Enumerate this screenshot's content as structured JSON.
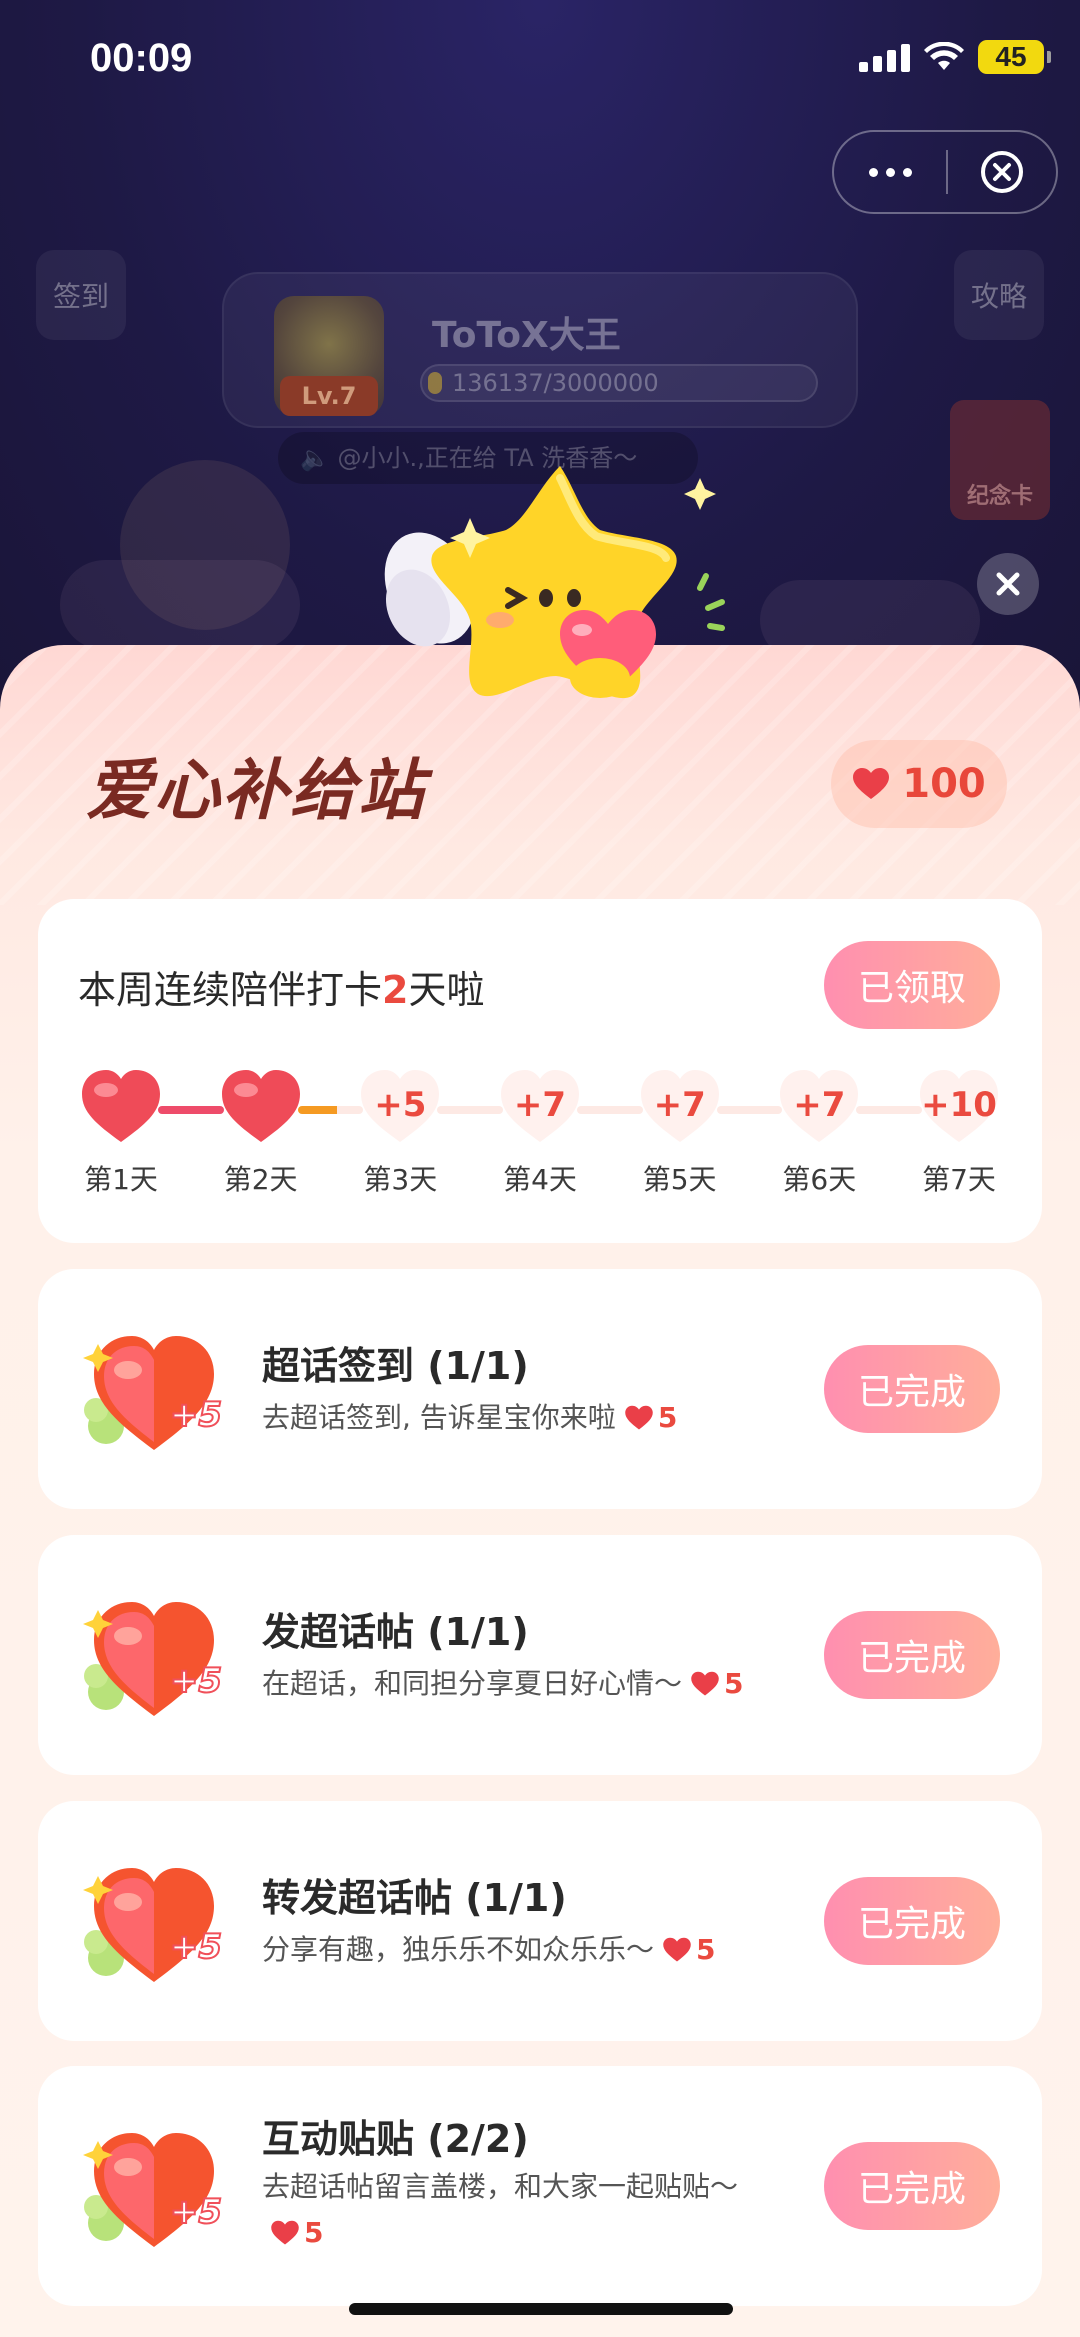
{
  "status_bar": {
    "time": "00:09",
    "battery": "45"
  },
  "background": {
    "checkin_label": "签到",
    "guide_label": "攻略",
    "profile_name": "ToToX大王",
    "level": "Lv.7",
    "progress_text": "136137/3000000",
    "notice": "@小小.,正在给 TA 洗香香～",
    "card_label": "纪念卡"
  },
  "sheet": {
    "title": "爱心补给站",
    "heart_count": "100",
    "streak": {
      "title_prefix": "本周连续陪伴打卡",
      "title_days": "2",
      "title_suffix": "天啦",
      "button_label": "已领取",
      "days": [
        {
          "label": "第1天",
          "state": "claimed",
          "points": ""
        },
        {
          "label": "第2天",
          "state": "claimed",
          "points": ""
        },
        {
          "label": "第3天",
          "state": "pending",
          "points": "+5"
        },
        {
          "label": "第4天",
          "state": "pending",
          "points": "+7"
        },
        {
          "label": "第5天",
          "state": "pending",
          "points": "+7"
        },
        {
          "label": "第6天",
          "state": "pending",
          "points": "+7"
        },
        {
          "label": "第7天",
          "state": "pending",
          "points": "+10"
        }
      ]
    },
    "tasks": [
      {
        "title": "超话签到 (1/1)",
        "desc": "去超话签到, 告诉星宝你来啦",
        "reward": "5",
        "icon_badge": "+5",
        "button_label": "已完成"
      },
      {
        "title": "发超话帖 (1/1)",
        "desc": " 在超话，和同担分享夏日好心情～",
        "reward": "5",
        "icon_badge": "+5",
        "button_label": "已完成"
      },
      {
        "title": "转发超话帖 (1/1)",
        "desc": "分享有趣，独乐乐不如众乐乐～",
        "reward": "5",
        "icon_badge": "+5",
        "button_label": "已完成"
      },
      {
        "title": "互动贴贴 (2/2)",
        "desc": "去超话帖留言盖楼，和大家一起贴贴～",
        "reward": "5",
        "icon_badge": "+5",
        "button_label": "已完成"
      }
    ]
  },
  "colors": {
    "accent": "#ea4a3f",
    "button_from": "#ff8fb0",
    "button_to": "#ffae9a",
    "title": "#7a2a22"
  }
}
